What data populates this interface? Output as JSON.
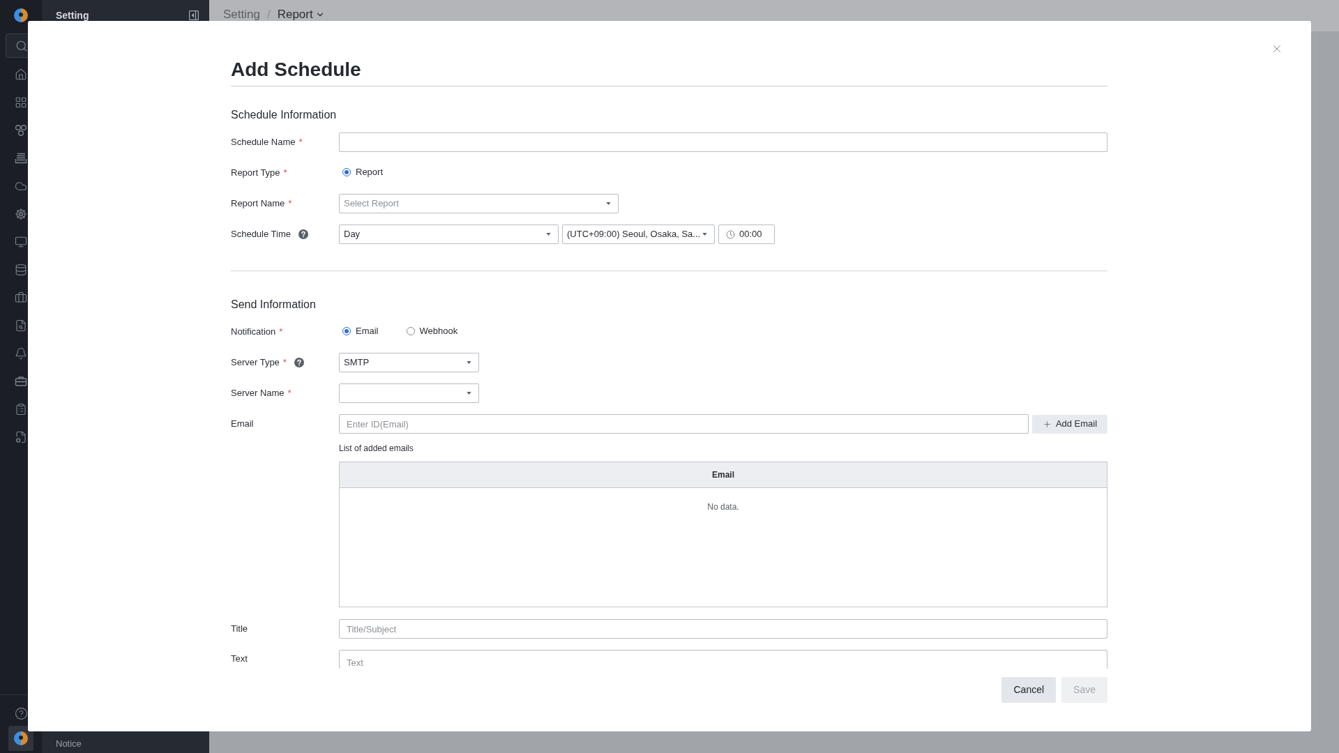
{
  "sidebar": {
    "title": "Setting",
    "footer_item": "Notice"
  },
  "breadcrumb": {
    "items": [
      "Setting",
      "Report"
    ],
    "separator": "/"
  },
  "modal": {
    "title": "Add Schedule",
    "sections": [
      {
        "title": "Schedule Information",
        "fields": [
          {
            "kind": "text",
            "label": "Schedule Name",
            "required_mark": "*"
          },
          {
            "kind": "radio",
            "label": "Report Type",
            "required_mark": "*",
            "options": [
              {
                "label": "Report",
                "selected": true
              }
            ]
          },
          {
            "kind": "select",
            "label": "Report Name",
            "required_mark": "*",
            "placeholder": "Select Report"
          },
          {
            "kind": "schedule",
            "label": "Schedule Time",
            "help": true,
            "frequency": "Day",
            "timezone": "(UTC+09:00) Seoul, Osaka, Sa...",
            "time": "00:00"
          }
        ]
      },
      {
        "title": "Send Information",
        "fields": [
          {
            "kind": "radio",
            "label": "Notification",
            "required_mark": "*",
            "options": [
              {
                "label": "Email",
                "selected": true
              },
              {
                "label": "Webhook",
                "selected": false
              }
            ]
          },
          {
            "kind": "select",
            "label": "Server Type",
            "required_mark": "*",
            "help": true,
            "value": "SMTP"
          },
          {
            "kind": "select",
            "label": "Server Name",
            "required_mark": "*"
          },
          {
            "kind": "email",
            "label": "Email",
            "placeholder": "Enter ID(Email)",
            "button": "Add Email",
            "list_label": "List of added emails",
            "table": {
              "columns": [
                "Email"
              ],
              "empty_text": "No data."
            }
          },
          {
            "kind": "text",
            "label": "Title",
            "placeholder": "Title/Subject"
          },
          {
            "kind": "textarea",
            "label": "Text",
            "placeholder": "Text"
          }
        ]
      }
    ],
    "buttons": [
      {
        "label": "Cancel",
        "disabled": false
      },
      {
        "label": "Save",
        "disabled": true
      }
    ]
  }
}
